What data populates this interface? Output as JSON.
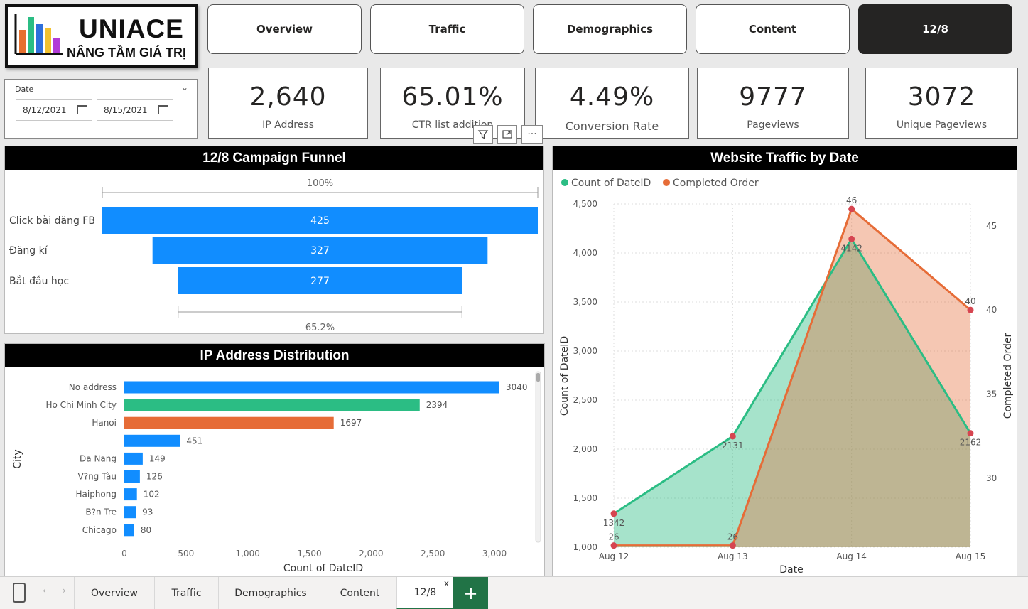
{
  "logo": {
    "title": "UNIACE",
    "subtitle": "NÂNG TẦM GIÁ TRỊ",
    "bar_colors": [
      "#e6702e",
      "#2bbd84",
      "#2e6fdb",
      "#f2c12e",
      "#b23bd6"
    ]
  },
  "nav": {
    "buttons": [
      "Overview",
      "Traffic",
      "Demographics",
      "Content",
      "12/8"
    ],
    "active_index": 4
  },
  "date_slicer": {
    "title": "Date",
    "start": "8/12/2021",
    "end": "8/15/2021"
  },
  "kpis": [
    {
      "value": "2,640",
      "label": "IP Address"
    },
    {
      "value": "65.01%",
      "label": "CTR list addition"
    },
    {
      "value": "4.49%",
      "label": "Conversion Rate"
    },
    {
      "value": "9777",
      "label": "Pageviews"
    },
    {
      "value": "3072",
      "label": "Unique Pageviews"
    }
  ],
  "visual_toolbar": {
    "filter_icon": "filter-icon",
    "focus_icon": "focus-mode-icon",
    "more_icon": "more-options-icon",
    "more_label": "···"
  },
  "colors": {
    "blue": "#118dff",
    "green": "#2bbd84",
    "orange": "#e66c37",
    "dark": "#252423",
    "accent_tab": "#217346"
  },
  "bottom_tabs": {
    "tabs": [
      "Overview",
      "Traffic",
      "Demographics",
      "Content",
      "12/8"
    ],
    "active_index": 4,
    "close_label": "x",
    "add_label": "+"
  },
  "chart_data": [
    {
      "type": "bar",
      "orientation": "funnel",
      "title": "12/8 Campaign Funnel",
      "categories": [
        "Click bài đăng FB",
        "Đăng kí",
        "Bắt đầu học"
      ],
      "values": [
        425,
        327,
        277
      ],
      "top_label": "100%",
      "bottom_label": "65.2%",
      "color": "#118dff"
    },
    {
      "type": "bar",
      "orientation": "horizontal",
      "title": "IP Address Distribution",
      "categories": [
        "No address",
        "Ho Chi Minh City",
        "Hanoi",
        "",
        "Da Nang",
        "V?ng Tàu",
        "Haiphong",
        "B?n Tre",
        "Chicago"
      ],
      "values": [
        3040,
        2394,
        1697,
        451,
        149,
        126,
        102,
        93,
        80
      ],
      "bar_colors": [
        "#118dff",
        "#2bbd84",
        "#e66c37",
        "#118dff",
        "#118dff",
        "#118dff",
        "#118dff",
        "#118dff",
        "#118dff"
      ],
      "xlabel": "Count of DateID",
      "ylabel": "City",
      "xlim": [
        0,
        3400
      ],
      "xticks": [
        0,
        500,
        1000,
        1500,
        2000,
        2500,
        3000
      ],
      "xtick_labels": [
        "0",
        "500",
        "1,000",
        "1,500",
        "2,000",
        "2,500",
        "3,000"
      ]
    },
    {
      "type": "area",
      "title": "Website Traffic by Date",
      "x": [
        "Aug 12",
        "Aug 13",
        "Aug 14",
        "Aug 15"
      ],
      "series": [
        {
          "name": "Count of DateID",
          "values": [
            1342,
            2131,
            4142,
            2162
          ],
          "axis": "left",
          "color": "#2bbd84"
        },
        {
          "name": "Completed Order",
          "values": [
            26,
            26,
            46,
            40
          ],
          "axis": "right",
          "color": "#e66c37"
        }
      ],
      "xlabel": "Date",
      "ylabel": "Count of DateID",
      "y2label": "Completed Order",
      "ylim": [
        1000,
        4500
      ],
      "yticks": [
        1000,
        1500,
        2000,
        2500,
        3000,
        3500,
        4000,
        4500
      ],
      "ytick_labels": [
        "1,000",
        "1,500",
        "2,000",
        "2,500",
        "3,000",
        "3,500",
        "4,000",
        "4,500"
      ],
      "y2lim": [
        25.9,
        46.3
      ],
      "y2ticks": [
        30,
        35,
        40,
        45
      ],
      "legend": "top-left",
      "grid": true
    }
  ]
}
